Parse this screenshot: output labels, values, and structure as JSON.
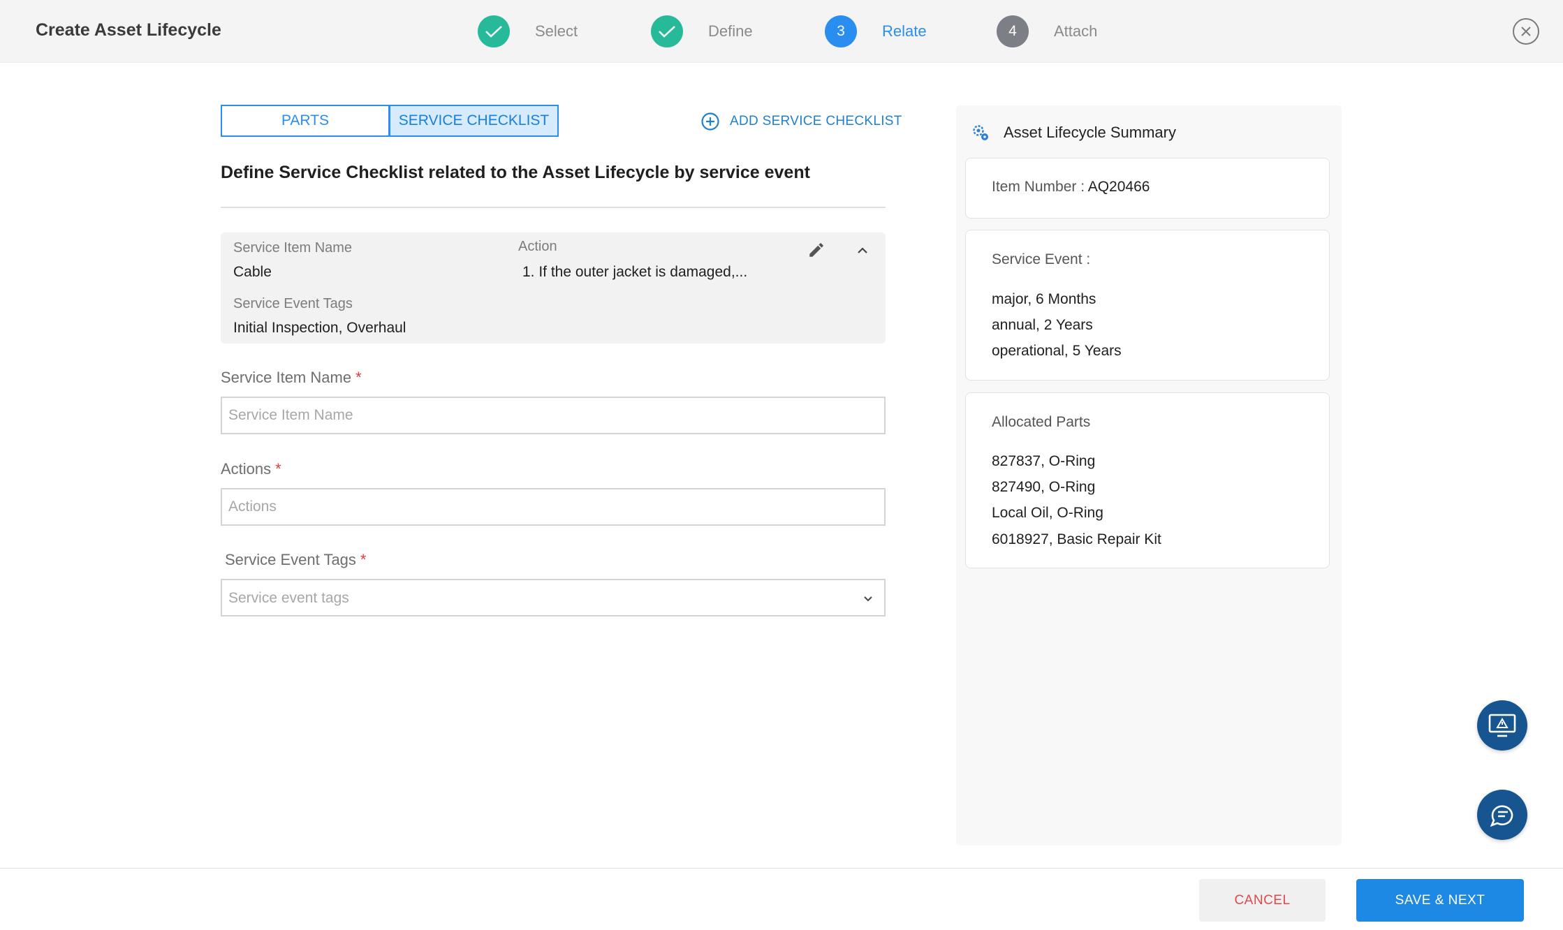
{
  "header": {
    "title": "Create Asset Lifecycle",
    "steps": [
      {
        "number": "",
        "label": "Select",
        "state": "done"
      },
      {
        "number": "",
        "label": "Define",
        "state": "done"
      },
      {
        "number": "3",
        "label": "Relate",
        "state": "active"
      },
      {
        "number": "4",
        "label": "Attach",
        "state": "pending"
      }
    ],
    "close_icon": "close-circle-icon"
  },
  "tabs": [
    {
      "label": "PARTS",
      "selected": false
    },
    {
      "label": "SERVICE CHECKLIST",
      "selected": true
    }
  ],
  "add_checklist": {
    "label": "ADD SERVICE CHECKLIST",
    "icon": "plus-circle-icon"
  },
  "section_title": "Define Service Checklist related to the Asset Lifecycle by service event",
  "item_card": {
    "service_item_name_label": "Service Item Name",
    "service_item_name": "Cable",
    "action_label": "Action",
    "action_value": "1. If the outer jacket is damaged,...",
    "tags_label": "Service Event Tags",
    "tags_value": "Initial Inspection, Overhaul"
  },
  "form": {
    "service_item_name": {
      "label": "Service Item Name",
      "required": "*",
      "placeholder": "Service Item Name"
    },
    "actions": {
      "label": "Actions",
      "required": "*",
      "placeholder": "Actions"
    },
    "service_event_tags": {
      "label": "Service Event Tags",
      "required": "*",
      "placeholder": "Service event tags"
    }
  },
  "summary": {
    "title": "Asset Lifecycle Summary",
    "item_number_label": "Item Number : ",
    "item_number_value": "AQ20466",
    "service_event_label": "Service Event :",
    "service_events": [
      "major, 6 Months",
      "annual, 2 Years",
      "operational, 5 Years"
    ],
    "allocated_parts_label": "Allocated Parts",
    "allocated_parts": [
      "827837, O-Ring",
      "827490, O-Ring",
      "Local Oil, O-Ring",
      "6018927, Basic Repair Kit"
    ]
  },
  "footer": {
    "cancel_label": "CANCEL",
    "save_label": "SAVE & NEXT"
  },
  "colors": {
    "accent": "#2a8ef0",
    "done": "#26b99a",
    "pending": "#7c7f86",
    "fab": "#16558f",
    "cancel_text": "#e0494a"
  }
}
